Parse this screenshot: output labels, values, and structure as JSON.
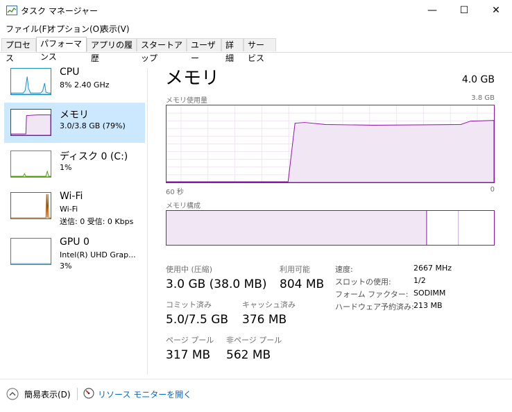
{
  "window": {
    "title": "タスク マネージャー",
    "minimize_glyph": "—",
    "maximize_glyph": "☐",
    "close_glyph": "✕"
  },
  "menu": [
    "ファイル(F)",
    "オプション(O)",
    "表示(V)"
  ],
  "tabs": [
    {
      "label": "プロセス",
      "active": false
    },
    {
      "label": "パフォーマンス",
      "active": true
    },
    {
      "label": "アプリの履歴",
      "active": false
    },
    {
      "label": "スタートアップ",
      "active": false
    },
    {
      "label": "ユーザー",
      "active": false
    },
    {
      "label": "詳細",
      "active": false
    },
    {
      "label": "サービス",
      "active": false
    }
  ],
  "sidebar": [
    {
      "title": "CPU",
      "lines": [
        "8%  2.40 GHz"
      ],
      "color": "#1a8fc6"
    },
    {
      "title": "メモリ",
      "lines": [
        "3.0/3.8 GB (79%)"
      ],
      "color": "#8b12ae",
      "selected": true
    },
    {
      "title": "ディスク 0 (C:)",
      "lines": [
        "1%"
      ],
      "color": "#4da60c"
    },
    {
      "title": "Wi-Fi",
      "lines": [
        "Wi-Fi",
        "送信: 0  受信: 0 Kbps"
      ],
      "color": "#a74f01"
    },
    {
      "title": "GPU 0",
      "lines": [
        "Intel(R) UHD Grap...",
        "3%"
      ],
      "color": "#1a8fc6"
    }
  ],
  "main": {
    "title": "メモリ",
    "total": "4.0 GB",
    "usage_label": "メモリ使用量",
    "usage_max": "3.8 GB",
    "time_left": "60 秒",
    "time_right": "0",
    "composition_label": "メモリ構成",
    "accent": "#8b12ae"
  },
  "stats": {
    "in_use_label": "使用中 (圧縮)",
    "in_use_value": "3.0 GB (38.0 MB)",
    "available_label": "利用可能",
    "available_value": "804 MB",
    "committed_label": "コミット済み",
    "committed_value": "5.0/7.5 GB",
    "cached_label": "キャッシュ済み",
    "cached_value": "376 MB",
    "paged_label": "ページ プール",
    "paged_value": "317 MB",
    "nonpaged_label": "非ページ プール",
    "nonpaged_value": "562 MB"
  },
  "specs": [
    {
      "label": "速度:",
      "value": "2667 MHz"
    },
    {
      "label": "スロットの使用:",
      "value": "1/2"
    },
    {
      "label": "フォーム ファクター:",
      "value": "SODIMM"
    },
    {
      "label": "ハードウェア予約済み:",
      "value": "213 MB"
    }
  ],
  "footer": {
    "fewer_details": "簡易表示(D)",
    "resource_monitor": "リソース モニターを開く"
  }
}
